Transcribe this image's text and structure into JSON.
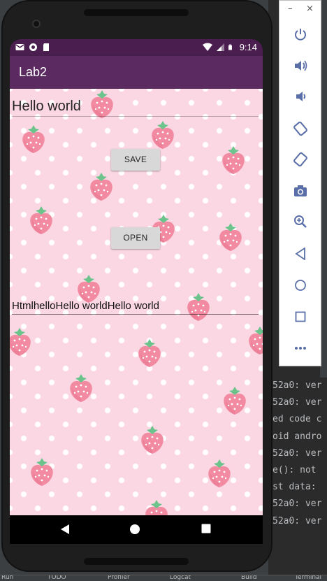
{
  "app": {
    "title": "Lab2",
    "status_time": "9:14",
    "hello_text": "Hello world",
    "save_label": "SAVE",
    "open_label": "OPEN",
    "result_text": "HtmlhelloHello worldHello world"
  },
  "ide": {
    "log_lines": [
      "52a0: ver",
      "52a0: ver",
      "ed code c",
      "oid andro",
      "52a0: ver",
      "e(): not",
      "st data:",
      "52a0: ver",
      "52a0: ver"
    ],
    "statusbar": [
      "Run",
      "TODO",
      "Profiler",
      "Logcat",
      "Build",
      "Terminal"
    ]
  },
  "emulator_toolbar": {
    "buttons": [
      "power-icon",
      "volume-up-icon",
      "volume-down-icon",
      "rotate-left-icon",
      "rotate-right-icon",
      "camera-icon",
      "zoom-icon",
      "back-icon",
      "home-icon",
      "overview-icon",
      "more-icon"
    ],
    "minimize": "–",
    "close": "×"
  },
  "colors": {
    "app_bar": "#5b2a60",
    "status_bar": "#4a1f4f",
    "content_bg": "#fbd7e4",
    "strawberry": "#f28ba1",
    "leaf": "#6cc48c"
  }
}
